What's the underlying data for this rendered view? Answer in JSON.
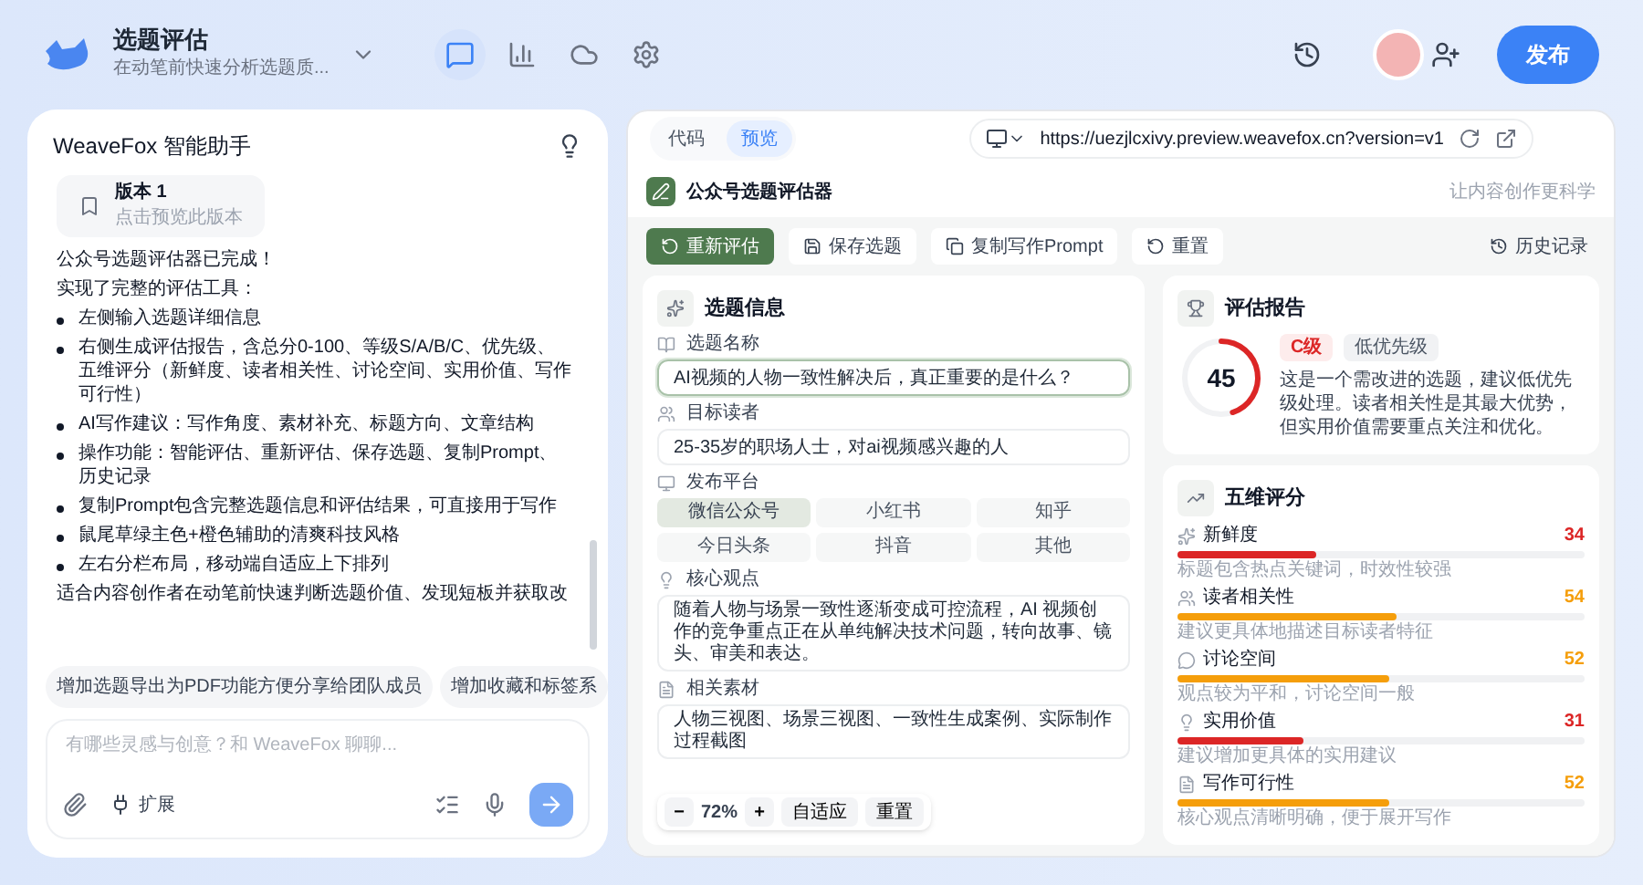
{
  "app": {
    "title": "选题评估",
    "subtitle": "在动笔前快速分析选题质...",
    "views": [
      {
        "kind": "chat",
        "selected": true
      },
      {
        "kind": "chart",
        "selected": false
      },
      {
        "kind": "cloud",
        "selected": false
      },
      {
        "kind": "settings",
        "selected": false
      }
    ],
    "publish_button": "发布"
  },
  "assistant": {
    "title": "WeaveFox 智能助手",
    "version_card": {
      "title": "版本 1",
      "hint": "点击预览此版本"
    },
    "messages": [
      {
        "kind": "paragraph",
        "text": "公众号选题评估器已完成！"
      },
      {
        "kind": "paragraph",
        "text": "实现了完整的评估工具："
      },
      {
        "kind": "bullet",
        "text": "左侧输入选题详细信息"
      },
      {
        "kind": "bullet",
        "text": "右侧生成评估报告，含总分0-100、等级S/A/B/C、优先级、五维评分（新鲜度、读者相关性、讨论空间、实用价值、写作可行性）"
      },
      {
        "kind": "bullet",
        "text": "AI写作建议：写作角度、素材补充、标题方向、文章结构"
      },
      {
        "kind": "bullet",
        "text": "操作功能：智能评估、重新评估、保存选题、复制Prompt、历史记录"
      },
      {
        "kind": "bullet",
        "text": "复制Prompt包含完整选题信息和评估结果，可直接用于写作"
      },
      {
        "kind": "bullet",
        "text": "鼠尾草绿主色+橙色辅助的清爽科技风格"
      },
      {
        "kind": "bullet",
        "text": "左右分栏布局，移动端自适应上下排列"
      },
      {
        "kind": "paragraph",
        "text": "适合内容创作者在动笔前快速判断选题价值、发现短板并获取改"
      }
    ],
    "suggestions": [
      "增加选题导出为PDF功能方便分享给团队成员",
      "增加收藏和标签系"
    ],
    "input": {
      "placeholder": "有哪些灵感与创意？和 WeaveFox 聊聊..."
    },
    "extend_button": "扩展"
  },
  "preview": {
    "tabs": [
      {
        "label": "代码",
        "selected": false
      },
      {
        "label": "预览",
        "selected": true
      }
    ],
    "url": "https://uezjlcxivy.preview.weavefox.cn?version=v1",
    "app_title": "公众号选题评估器",
    "tagline": "让内容创作更科学",
    "actions": [
      {
        "kind": "primary",
        "label": "重新评估"
      },
      {
        "kind": "save",
        "label": "保存选题"
      },
      {
        "kind": "copy",
        "label": "复制写作Prompt"
      },
      {
        "kind": "reset",
        "label": "重置"
      }
    ],
    "history_button": "历史记录",
    "form": {
      "title": "选题信息",
      "fields": [
        {
          "kind": "input",
          "label": "选题名称",
          "value": "AI视频的人物一致性解决后，真正重要的是什么？",
          "focused": true
        },
        {
          "kind": "input",
          "label": "目标读者",
          "value": "25-35岁的职场人士，对ai视频感兴趣的人",
          "focused": false
        },
        {
          "kind": "options",
          "label": "发布平台",
          "options": [
            {
              "label": "微信公众号",
              "selected": true
            },
            {
              "label": "小红书",
              "selected": false
            },
            {
              "label": "知乎",
              "selected": false
            },
            {
              "label": "今日头条",
              "selected": false
            },
            {
              "label": "抖音",
              "selected": false
            },
            {
              "label": "其他",
              "selected": false
            }
          ]
        },
        {
          "kind": "textarea",
          "label": "核心观点",
          "value": "随着人物与场景一致性逐渐变成可控流程，AI 视频创作的竞争重点正在从单纯解决技术问题，转向故事、镜头、审美和表达。"
        },
        {
          "kind": "textarea",
          "label": "相关素材",
          "value": "人物三视图、场景三视图、一致性生成案例、实际制作过程截图"
        }
      ]
    },
    "zoom": {
      "minus": "−",
      "level": "72%",
      "plus": "+",
      "fit": "自适应",
      "reset": "重置"
    },
    "report": {
      "title": "评估报告",
      "score": "45",
      "level": 0.45,
      "grade": "C级",
      "priority": "低优先级",
      "summary": "这是一个需改进的选题，建议低优先级处理。读者相关性是其最大优势，但实用价值需要重点关注和优化。"
    },
    "dimensions": {
      "title": "五维评分",
      "rows": [
        {
          "name": "新鲜度",
          "score": "34",
          "level": 0.34,
          "color": "#dc2626",
          "note": "标题包含热点关键词，时效性较强"
        },
        {
          "name": "读者相关性",
          "score": "54",
          "level": 0.54,
          "color": "#f59e0b",
          "note": "建议更具体地描述目标读者特征"
        },
        {
          "name": "讨论空间",
          "score": "52",
          "level": 0.52,
          "color": "#f59e0b",
          "note": "观点较为平和，讨论空间一般"
        },
        {
          "name": "实用价值",
          "score": "31",
          "level": 0.31,
          "color": "#dc2626",
          "note": "建议增加更具体的实用建议"
        },
        {
          "name": "写作可行性",
          "score": "52",
          "level": 0.52,
          "color": "#f59e0b",
          "note": "核心观点清晰明确，便于展开写作"
        }
      ]
    }
  }
}
